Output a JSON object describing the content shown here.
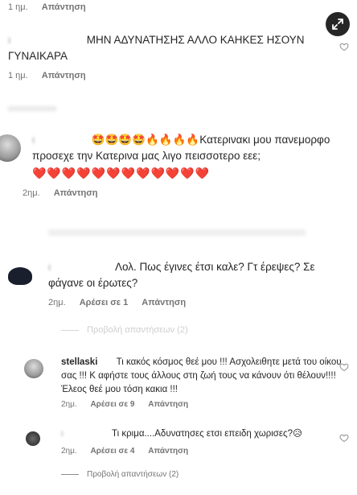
{
  "comments": [
    {
      "meta": {
        "time": "1 ημ.",
        "reply": "Απάντηση"
      }
    },
    {
      "username": "ι",
      "text": "ΜΗΝ ΑΔΥΝΑΤΗΣΗΣ ΑΛΛΟ ΚΑΗΚΕΣ ΗΣΟΥΝ ΓΥΝΑΙΚΑΡΑ",
      "meta": {
        "time": "1 ημ.",
        "reply": "Απάντηση"
      }
    },
    {
      "emojis_lead": "🤩🤩🤩🤩🔥🔥🔥🔥",
      "text": "Κατερινακι μου πανεμορφο προσεχε την Κατερινα μας λιγο πεισσοτερο εεε;",
      "hearts": "❤️❤️❤️❤️❤️❤️❤️❤️❤️❤️❤️❤️",
      "meta": {
        "time": "2ημ.",
        "reply": "Απάντηση"
      }
    },
    {
      "text": "Λολ. Πως έγινες έτσι καλε? Γτ έρεψες? Σε φάγανε οι έρωτες?",
      "meta": {
        "time": "2ημ.",
        "likes": "Αρέσει σε 1",
        "reply": "Απάντηση"
      },
      "view_replies": "Προβολή απαντήσεων (2)"
    },
    {
      "username": "stellaski",
      "text": "Τι κακός κόσμος θεέ μου !!! Ασχολειθητε μετά του οίκου σας !!! Κ αφήστε τους άλλους στη ζωή τους να κάνουν ότι θέλουν!!!! Έλεος θεέ μου τόση κακια !!!",
      "meta": {
        "time": "2ημ.",
        "likes": "Αρέσει σε 9",
        "reply": "Απάντηση"
      }
    },
    {
      "text": "Τι κριμα....Αδυνατησες ετσι επειδη χωρισες?",
      "emoji_end": "😥",
      "meta": {
        "time": "2ημ.",
        "likes": "Αρέσει σε 4",
        "reply": "Απάντηση"
      },
      "view_replies": "Προβολή απαντήσεων (2)"
    }
  ],
  "icons": {
    "heart": "heart-outline-icon",
    "expand": "expand-arrows-icon"
  }
}
